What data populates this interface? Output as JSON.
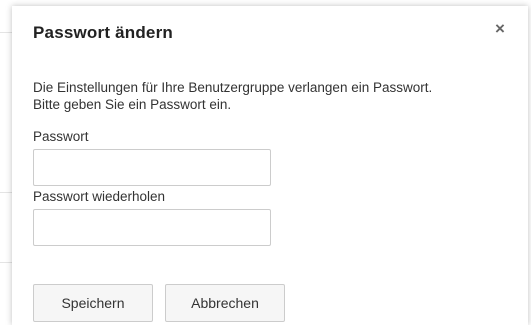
{
  "dialog": {
    "title": "Passwort ändern",
    "close_symbol": "×",
    "close_icon": "close-icon",
    "message_line1": "Die Einstellungen für Ihre Benutzergruppe verlangen ein Passwort.",
    "message_line2": "Bitte geben Sie ein Passwort ein.",
    "password_label": "Passwort",
    "password_value": "",
    "password_repeat_label": "Passwort wiederholen",
    "password_repeat_value": "",
    "save_label": "Speichern",
    "cancel_label": "Abbrechen"
  }
}
